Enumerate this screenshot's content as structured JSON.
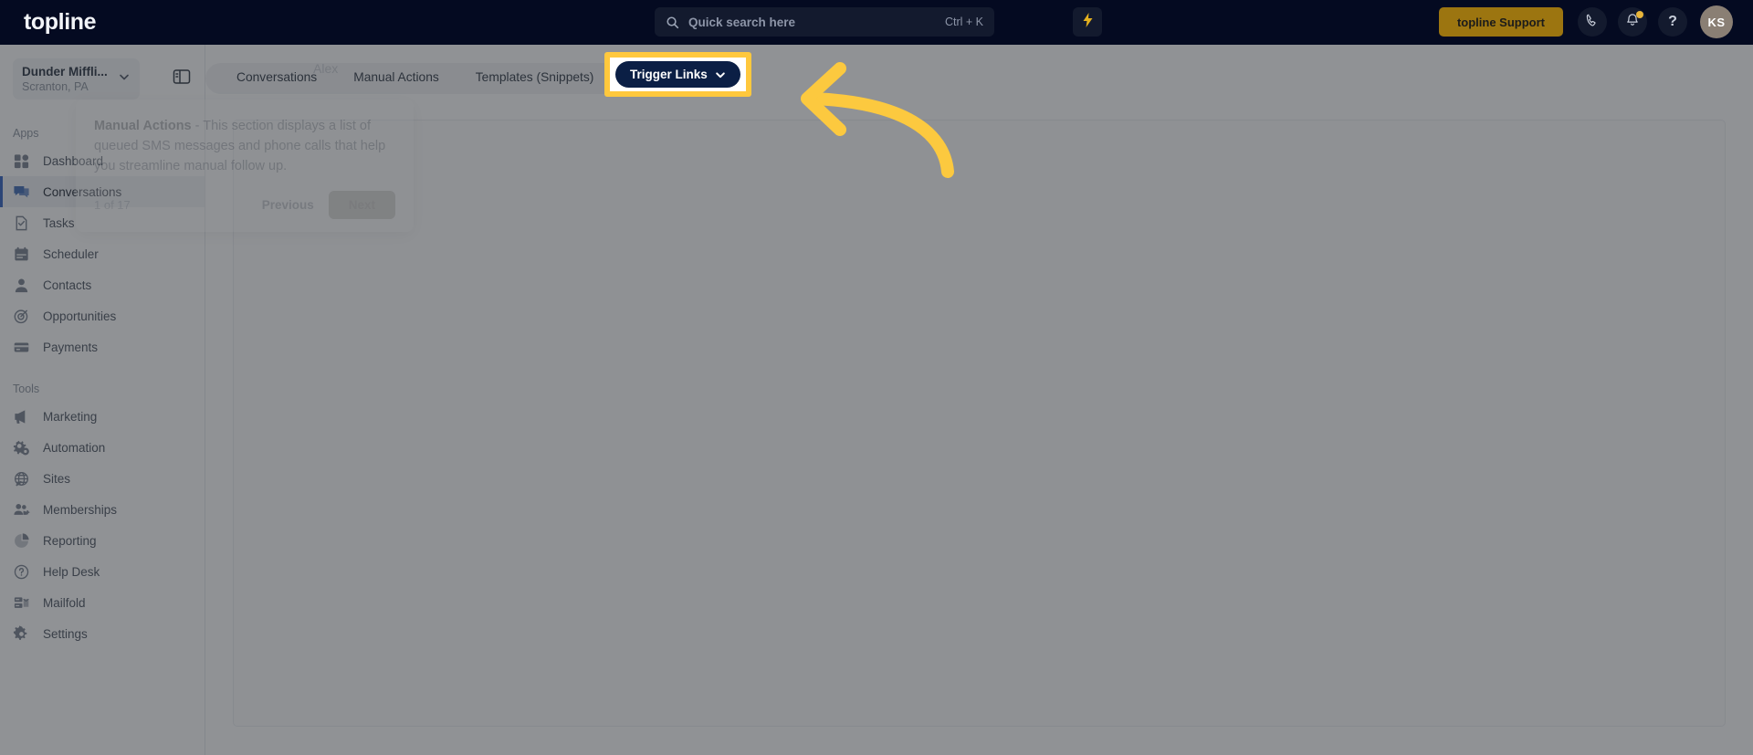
{
  "topbar": {
    "logo": "topline",
    "search": {
      "placeholder": "Quick search here",
      "shortcut": "Ctrl + K",
      "icon": "search-icon"
    },
    "quick_action_icon": "lightning-bolt-icon",
    "support_button": "topline Support",
    "icons": [
      {
        "name": "phone-icon",
        "label": ""
      },
      {
        "name": "bell-icon",
        "label": ""
      },
      {
        "name": "help-icon",
        "label": "?"
      }
    ],
    "avatar_initials": "KS",
    "colors": {
      "bar_background": "#040a21",
      "support_button": "#9c7510",
      "accent_yellow": "#e3b01f",
      "avatar": "#8a7f74"
    }
  },
  "sidebar": {
    "location": {
      "name": "Dunder Miffli...",
      "sublabel": "Scranton, PA",
      "chevron_icon": "chevron-down-icon"
    },
    "panel_toggle_icon": "panel-toggle-icon",
    "groups": [
      {
        "label": "Apps",
        "items": [
          {
            "label": "Dashboard",
            "icon": "dashboard-icon",
            "active": false
          },
          {
            "label": "Conversations",
            "icon": "conversations-icon",
            "active": true
          },
          {
            "label": "Tasks",
            "icon": "tasks-icon",
            "active": false
          },
          {
            "label": "Scheduler",
            "icon": "calendar-icon",
            "active": false
          },
          {
            "label": "Contacts",
            "icon": "contacts-icon",
            "active": false
          },
          {
            "label": "Opportunities",
            "icon": "target-icon",
            "active": false
          },
          {
            "label": "Payments",
            "icon": "card-icon",
            "active": false
          }
        ]
      },
      {
        "label": "Tools",
        "items": [
          {
            "label": "Marketing",
            "icon": "megaphone-icon",
            "active": false
          },
          {
            "label": "Automation",
            "icon": "gears-icon",
            "active": false
          },
          {
            "label": "Sites",
            "icon": "globe-icon",
            "active": false
          },
          {
            "label": "Memberships",
            "icon": "members-icon",
            "active": false
          },
          {
            "label": "Reporting",
            "icon": "pie-chart-icon",
            "active": false
          },
          {
            "label": "Help Desk",
            "icon": "help-circle-icon",
            "active": false
          },
          {
            "label": "Mailfold",
            "icon": "mailfold-icon",
            "active": false
          },
          {
            "label": "Settings",
            "icon": "gear-icon",
            "active": false
          }
        ]
      }
    ]
  },
  "main": {
    "tabs": [
      {
        "label": "Conversations"
      },
      {
        "label": "Manual Actions"
      },
      {
        "label": "Templates (Snippets)"
      }
    ],
    "trigger_links": {
      "label": "Trigger Links",
      "chevron_icon": "chevron-down-icon",
      "highlighted": true,
      "highlight_color": "#ffc83d",
      "button_color": "#0b1f45"
    }
  },
  "tour_popover": {
    "title": "Manual Actions",
    "separator": " - ",
    "body": "This section displays a list of queued SMS messages and phone calls that help you streamline manual follow up.",
    "step_counter": "1 of 17",
    "previous_label": "Previous",
    "next_label": "Next",
    "ghost_name": "Alex"
  },
  "annotation": {
    "arrow_color": "#fcc93f",
    "points_to": "trigger-links-button"
  }
}
